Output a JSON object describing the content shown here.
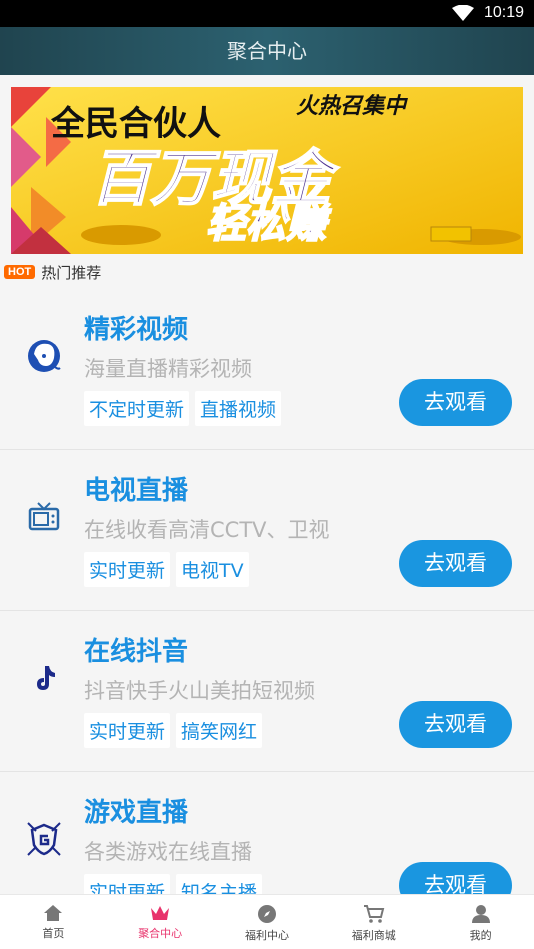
{
  "status_bar": {
    "time": "10:19"
  },
  "header": {
    "title": "聚合中心"
  },
  "banner": {
    "line1": "全民合伙人",
    "line1_tail": "火热召集中",
    "line2": "百万现金",
    "line3": "轻松赚"
  },
  "hot": {
    "badge": "HOT",
    "label": "热门推荐"
  },
  "cards": [
    {
      "title": "精彩视频",
      "subtitle": "海量直播精彩视频",
      "tags": [
        "不定时更新",
        "直播视频"
      ],
      "button": "去观看",
      "icon": "woman-face-icon"
    },
    {
      "title": "电视直播",
      "subtitle": "在线收看高清CCTV、卫视",
      "tags": [
        "实时更新",
        "电视TV"
      ],
      "button": "去观看",
      "icon": "tv-icon"
    },
    {
      "title": "在线抖音",
      "subtitle": "抖音快手火山美拍短视频",
      "tags": [
        "实时更新",
        "搞笑网红"
      ],
      "button": "去观看",
      "icon": "tiktok-icon"
    },
    {
      "title": "游戏直播",
      "subtitle": "各类游戏在线直播",
      "tags": [
        "实时更新",
        "知名主播"
      ],
      "button": "去观看",
      "icon": "game-shield-icon"
    }
  ],
  "tabbar": [
    {
      "label": "首页",
      "icon": "home-icon"
    },
    {
      "label": "聚合中心",
      "icon": "crown-icon",
      "active": true
    },
    {
      "label": "福利中心",
      "icon": "compass-icon"
    },
    {
      "label": "福利商城",
      "icon": "cart-icon"
    },
    {
      "label": "我的",
      "icon": "user-icon"
    }
  ],
  "colors": {
    "accent": "#1a96e0",
    "title_blue": "#1a8fe0",
    "active_tab": "#e8336c",
    "hot": "#ff6a00"
  }
}
